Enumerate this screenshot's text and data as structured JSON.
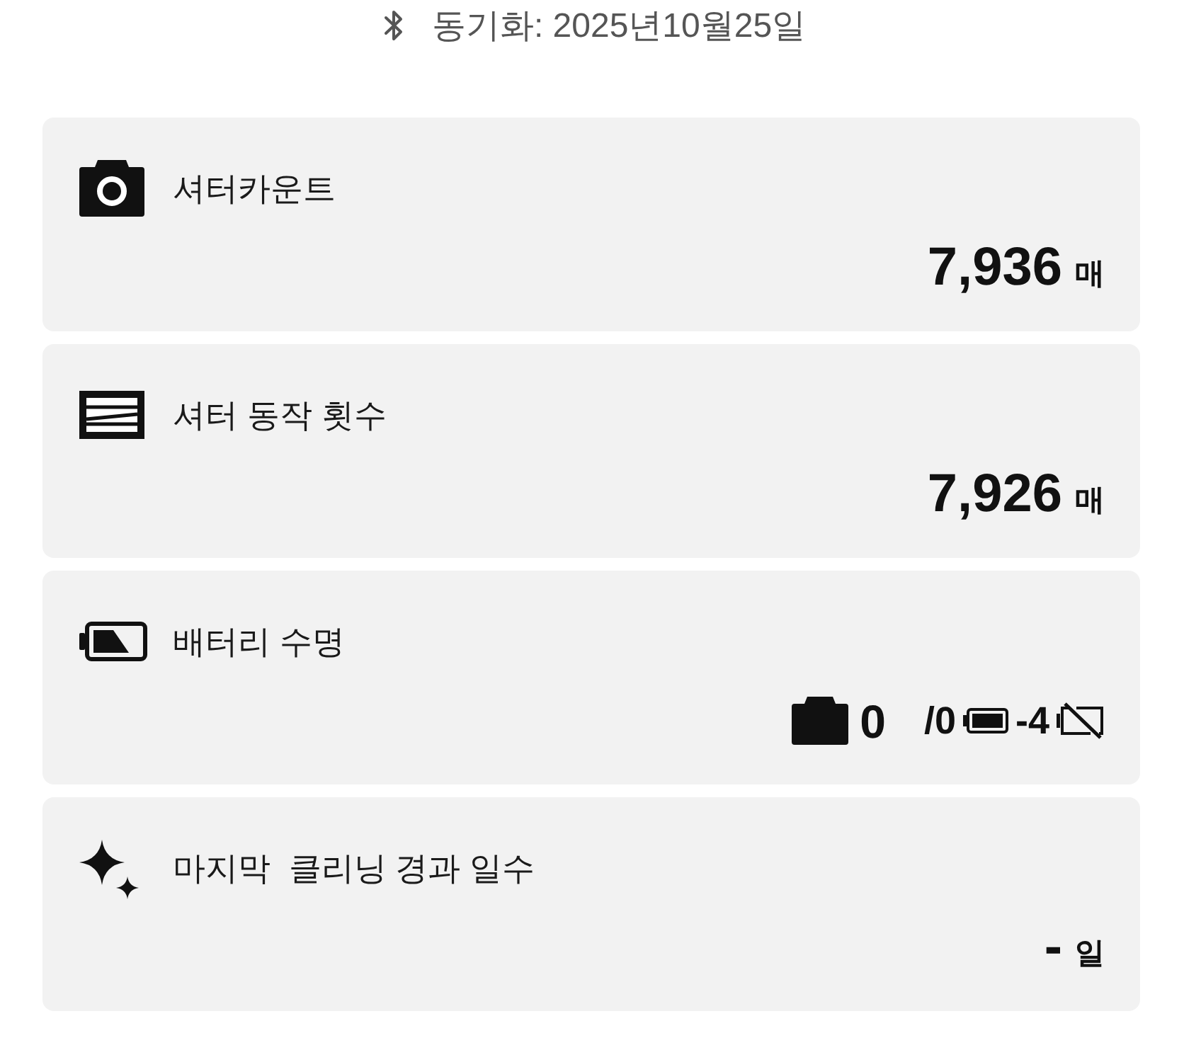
{
  "sync": {
    "text": "동기화: 2025년10월25일"
  },
  "cards": [
    {
      "kind": "shutter",
      "title": "셔터카운트",
      "value": "7,936",
      "unit": "매"
    },
    {
      "kind": "actuation",
      "title": "셔터 동작 횟수",
      "value": "7,926",
      "unit": "매"
    },
    {
      "kind": "battery",
      "title": "배터리 수명",
      "parts": [
        {
          "kind": "body_icon"
        },
        {
          "kind": "big",
          "text": "0"
        },
        {
          "kind": "small",
          "text": "/0"
        },
        {
          "kind": "battery_icon"
        },
        {
          "kind": "small",
          "text": "-4"
        },
        {
          "kind": "no_battery_icon"
        }
      ]
    },
    {
      "kind": "cleaning",
      "title": "마지막  클리닝 경과 일수",
      "value": "-",
      "unit": "일"
    }
  ]
}
